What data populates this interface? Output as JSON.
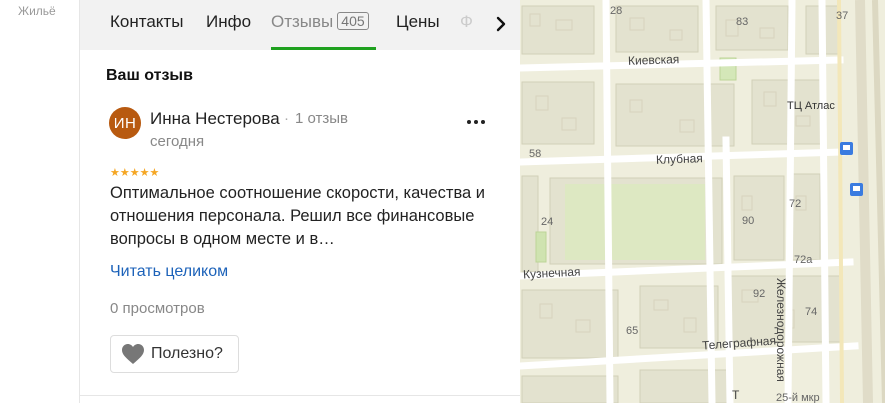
{
  "breadcrumb": {
    "label": "Жильё"
  },
  "tabs": {
    "items": [
      {
        "label": "Контакты"
      },
      {
        "label": "Инфо"
      },
      {
        "label": "Отзывы",
        "badge": "405",
        "active": true
      },
      {
        "label": "Цены"
      }
    ],
    "faded_label": "Ф"
  },
  "review": {
    "section_title": "Ваш отзыв",
    "avatar_initials": "ИН",
    "author_name": "Инна Нестерова",
    "author_reviews": "1 отзыв",
    "date": "сегодня",
    "rating": 5,
    "text": "Оптимальное соотношение скорости, качества и отношения персонала. Решил все финансовые вопросы в одном месте и в…",
    "read_more": "Читать целиком",
    "views": "0 просмотров",
    "useful_label": "Полезно?"
  },
  "map": {
    "streets": [
      "Киевская",
      "Клубная",
      "Кузнечная",
      "Телеграфная",
      "Железнодорожная",
      "Т",
      "25-й мкр"
    ],
    "poi": [
      "ТЦ Атлас"
    ],
    "house_numbers": [
      "28",
      "83",
      "37",
      "58",
      "90",
      "72",
      "24",
      "72а",
      "92",
      "74",
      "65"
    ]
  },
  "colors": {
    "accent_green": "#1fa11f",
    "link_blue": "#1c62b9",
    "avatar_bg": "#b85a10",
    "star": "#f5a623",
    "map_bg": "#efeedd",
    "transit_blue": "#3a7be0"
  }
}
